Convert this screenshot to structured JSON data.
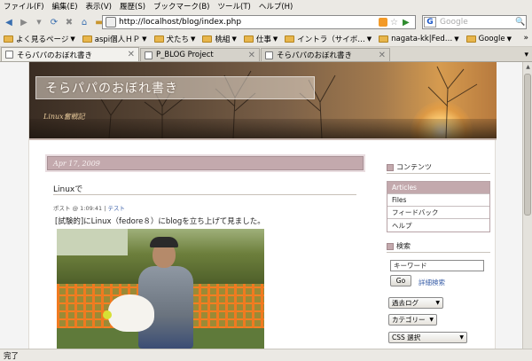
{
  "browser": {
    "menu": [
      "ファイル(F)",
      "編集(E)",
      "表示(V)",
      "履歴(S)",
      "ブックマーク(B)",
      "ツール(T)",
      "ヘルプ(H)"
    ],
    "url": "http://localhost/blog/index.php",
    "search_placeholder": "Google",
    "search_engine_label": "G"
  },
  "bookmarks": [
    {
      "label": "よく見るページ",
      "has_arrow": true
    },
    {
      "label": "aspi個人ＨＰ",
      "has_arrow": true
    },
    {
      "label": "犬たち",
      "has_arrow": true
    },
    {
      "label": "桃組",
      "has_arrow": true
    },
    {
      "label": "仕事",
      "has_arrow": true
    },
    {
      "label": "イントラ（サイボ…",
      "has_arrow": true
    },
    {
      "label": "nagata-kk|Fed…",
      "has_arrow": true
    },
    {
      "label": "Google",
      "has_arrow": true
    }
  ],
  "bookmarks_more": "»",
  "tabs": [
    {
      "title": "そらパパのおぼれ書き",
      "active": true
    },
    {
      "title": "P_BLOG Project",
      "active": false
    },
    {
      "title": "そらパパのおぼれ書き",
      "active": false
    }
  ],
  "page": {
    "site_title": "そらパパのおぼれ書き",
    "site_subtitle": "Linux奮戦記",
    "post_date": "Apr 17, 2009",
    "post_title": "Linuxで",
    "post_meta_prefix": "ポスト @ 1:09:41 | ",
    "post_category": "テスト",
    "post_body": "[試験的]にLinux（fedore８）にblogを立ち上げて見ました。"
  },
  "sidebar": {
    "contents_heading": "コンテンツ",
    "menu": [
      "Articles",
      "Files",
      "フィードバック",
      "ヘルプ"
    ],
    "search_heading": "検索",
    "search_value": "キーワード",
    "go_label": "Go",
    "advanced_search": "詳細検索",
    "archive_select": "過去ログ",
    "category_select": "カテゴリー",
    "css_select": "CSS 選択"
  },
  "status": "完了"
}
